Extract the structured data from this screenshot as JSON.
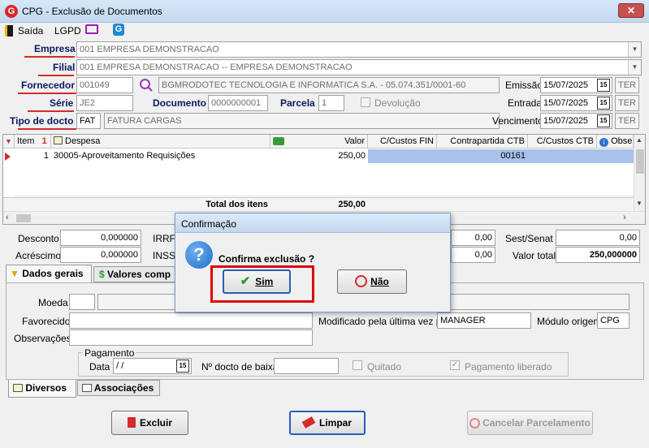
{
  "window": {
    "title": "CPG - Exclusão de Documentos",
    "logo_letter": "G",
    "close_glyph": "✕"
  },
  "menu": {
    "exit_label": "Saída",
    "lgpd_label": "LGPD"
  },
  "form": {
    "empresa_label": "Empresa",
    "empresa_value": "001 EMPRESA DEMONSTRACAO",
    "filial_label": "Filial",
    "filial_value": "001 EMPRESA DEMONSTRACAO -- EMPRESA DEMONSTRACAO",
    "fornecedor_label": "Fornecedor",
    "fornecedor_code": "001049",
    "fornecedor_name": "BGMRODOTEC TECNOLOGIA E INFORMATICA S.A.  - 05.074.351/0001-60",
    "serie_label": "Série",
    "serie_value": "JE2",
    "documento_label": "Documento",
    "documento_value": "0000000001",
    "parcela_label": "Parcela",
    "parcela_value": "1",
    "devolucao_label": "Devolução",
    "tipo_label": "Tipo de docto",
    "tipo_code": "FAT",
    "tipo_desc": "FATURA CARGAS",
    "emissao_label": "Emissão",
    "emissao_value": "15/07/2025",
    "emissao_day": "TER",
    "entrada_label": "Entrada",
    "entrada_value": "15/07/2025",
    "entrada_day": "TER",
    "vencimento_label": "Vencimento",
    "vencimento_value": "15/07/2025",
    "vencimento_day": "TER",
    "cal_glyph": "15"
  },
  "grid": {
    "columns": [
      "Item",
      "Despesa",
      "Valor",
      "C/Custos FIN",
      "Contrapartida CTB",
      "C/Custos CTB",
      "Obse"
    ],
    "sort_glyph": "1",
    "rows": [
      {
        "item": "1",
        "despesa": "30005-Aproveitamento Requisições",
        "valor": "250,00",
        "contrapartida": "00161"
      }
    ],
    "total_label": "Total dos itens",
    "total_value": "250,00"
  },
  "totals": {
    "desconto_label": "Desconto",
    "desconto_value": "0,000000",
    "irrf_label": "IRRF",
    "acrescimo_label": "Acréscimo",
    "acrescimo_value": "0,000000",
    "inss_label": "INSS",
    "v1": "0,00",
    "v2": "0,00",
    "sest_label": "Sest/Senat",
    "sest_value": "0,00",
    "valor_total_label": "Valor total",
    "valor_total_value": "250,000000"
  },
  "tabs": {
    "dados_gerais": "Dados gerais",
    "valores": "Valores comp",
    "diversos": "Diversos",
    "associacoes": "Associações"
  },
  "general": {
    "moeda_label": "Moeda",
    "favorecido_label": "Favorecido",
    "observacoes_label": "Observações",
    "modificado_label": "Modificado pela última vez por",
    "modificado_value": "MANAGER",
    "modulo_label": "Módulo origem",
    "modulo_value": "CPG",
    "pagamento_title": "Pagamento",
    "data_label": "Data",
    "data_value": " /  /",
    "baixa_label": "Nº docto de baixa",
    "quitado_label": "Quitado",
    "pagamento_liberado_label": "Pagamento liberado"
  },
  "buttons": {
    "excluir": "Excluir",
    "limpar": "Limpar",
    "cancelar": "Cancelar Parcelamento"
  },
  "dialog": {
    "title": "Confirmação",
    "message": "Confirma exclusão ?",
    "yes": "Sim",
    "no": "Não",
    "icon_glyph": "?"
  },
  "colors": {
    "accent_red": "#d12c2c",
    "label_blue": "#0a1a5e",
    "selection": "#a9c2ec",
    "highlight_box": "#e00000"
  }
}
